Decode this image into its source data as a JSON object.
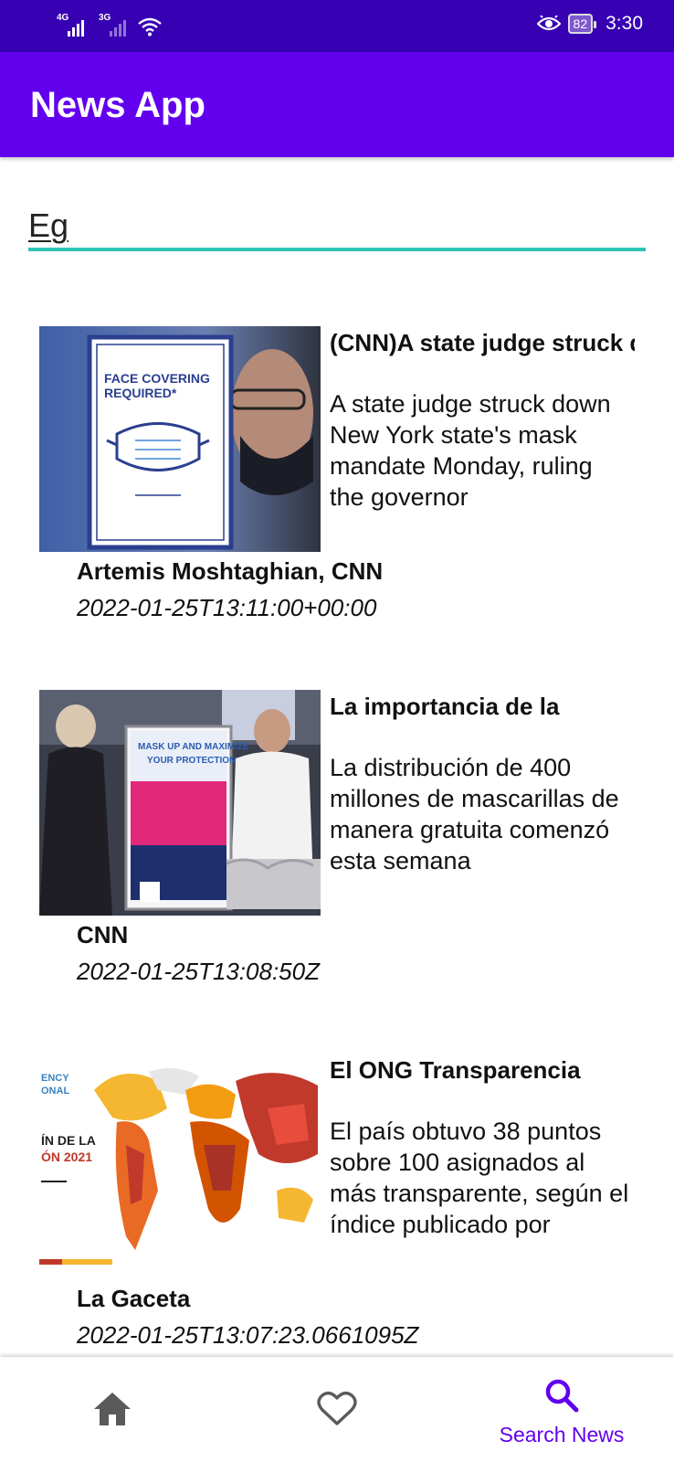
{
  "status_bar": {
    "sim1_tag": "4G",
    "sim2_tag": "3G",
    "battery": "82",
    "time": "3:30",
    "icons": [
      "signal-icon",
      "signal-icon",
      "wifi-icon",
      "eye-icon",
      "battery-icon"
    ]
  },
  "app_bar": {
    "title": "News App"
  },
  "search": {
    "value": "Eg"
  },
  "articles": [
    {
      "title": "(CNN)A state judge struck down New York state's mask mandate Monday",
      "description": "A state judge struck down New York state's mask mandate Monday, ruling the governor",
      "author": "Artemis Moshtaghian, CNN",
      "date": "2022-01-25T13:11:00+00:00",
      "image_text": "FACE COVERING REQUIRED*"
    },
    {
      "title": "La importancia de la",
      "description": "La distribución de 400 millones de mascarillas de manera gratuita comenzó esta semana",
      "author": "CNN",
      "date": "2022-01-25T13:08:50Z",
      "image_text": "MASK UP AND MAXIMIZE YOUR PROTECTION"
    },
    {
      "title": "El ONG Transparencia",
      "description": "El país obtuvo 38 puntos sobre 100 asignados al más transparente, según el índice publicado por",
      "author": "La Gaceta",
      "date": "2022-01-25T13:07:23.0661095Z",
      "image_text": "ÍN DE LA ÓN 2021"
    }
  ],
  "bottom_nav": {
    "active": "search",
    "active_color": "#6200ee",
    "items": [
      {
        "icon": "home-icon",
        "label": ""
      },
      {
        "icon": "heart-icon",
        "label": ""
      },
      {
        "icon": "search-icon",
        "label": "Search News"
      }
    ]
  },
  "colors": {
    "status_bar": "#3700b3",
    "app_bar": "#6200ee",
    "search_underline": "#2ec4b6"
  }
}
